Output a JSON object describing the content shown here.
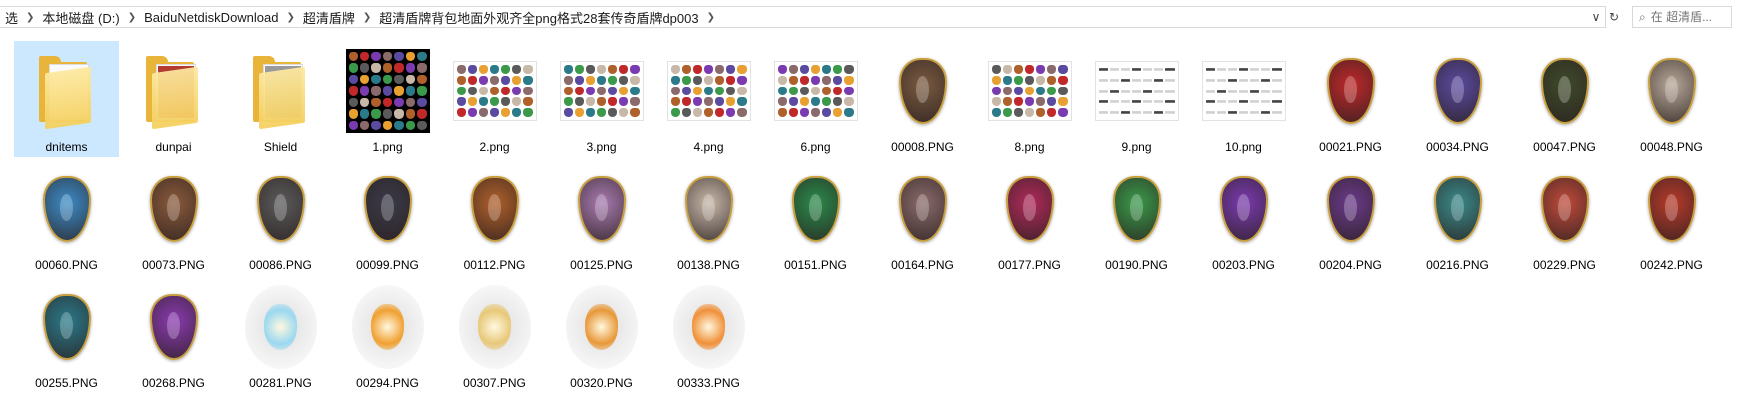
{
  "breadcrumb": [
    "选",
    "本地磁盘 (D:)",
    "BaiduNetdiskDownload",
    "超清盾牌",
    "超清盾牌背包地面外观齐全png格式28套传奇盾牌dp003"
  ],
  "search": {
    "placeholder": "在 超清盾..."
  },
  "colors": {
    "selection": "#cce8ff",
    "folder": "#e8b53a"
  },
  "files": [
    {
      "name": "dnitems",
      "kind": "folder",
      "preview": "none",
      "selected": true
    },
    {
      "name": "dunpai",
      "kind": "folder",
      "preview": "#b33a2e"
    },
    {
      "name": "Shield",
      "kind": "folder",
      "preview": "#9a9a9a"
    },
    {
      "name": "1.png",
      "kind": "sheet",
      "dark": true
    },
    {
      "name": "2.png",
      "kind": "sheet"
    },
    {
      "name": "3.png",
      "kind": "sheet"
    },
    {
      "name": "4.png",
      "kind": "sheet"
    },
    {
      "name": "6.png",
      "kind": "sheet"
    },
    {
      "name": "00008.PNG",
      "kind": "shield",
      "color": "#7a5a40"
    },
    {
      "name": "8.png",
      "kind": "sheet"
    },
    {
      "name": "9.png",
      "kind": "sheet",
      "sparse": true
    },
    {
      "name": "10.png",
      "kind": "sheet",
      "sparse": true
    },
    {
      "name": "00021.PNG",
      "kind": "shield",
      "color": "#c0282a"
    },
    {
      "name": "00034.PNG",
      "kind": "shield",
      "color": "#5a4aa0"
    },
    {
      "name": "00047.PNG",
      "kind": "shield",
      "color": "#3e4a2a"
    },
    {
      "name": "00048.PNG",
      "kind": "shield",
      "color": "#b8a898"
    },
    {
      "name": "00060.PNG",
      "kind": "shield",
      "color": "#3c8cc8"
    },
    {
      "name": "00073.PNG",
      "kind": "shield",
      "color": "#8a5a3a"
    },
    {
      "name": "00086.PNG",
      "kind": "shield",
      "color": "#5a5a5a"
    },
    {
      "name": "00099.PNG",
      "kind": "shield",
      "color": "#3a3a48"
    },
    {
      "name": "00112.PNG",
      "kind": "shield",
      "color": "#b0602a"
    },
    {
      "name": "00125.PNG",
      "kind": "shield",
      "color": "#a87ab0"
    },
    {
      "name": "00138.PNG",
      "kind": "shield",
      "color": "#c8b8a8"
    },
    {
      "name": "00151.PNG",
      "kind": "shield",
      "color": "#2a8a4a"
    },
    {
      "name": "00164.PNG",
      "kind": "shield",
      "color": "#8a6a6a"
    },
    {
      "name": "00177.PNG",
      "kind": "shield",
      "color": "#b02a5a"
    },
    {
      "name": "00190.PNG",
      "kind": "shield",
      "color": "#3a9a4a"
    },
    {
      "name": "00203.PNG",
      "kind": "shield",
      "color": "#7a3ab0"
    },
    {
      "name": "00204.PNG",
      "kind": "shield",
      "color": "#6a3a8a"
    },
    {
      "name": "00216.PNG",
      "kind": "shield",
      "color": "#3a8a8a"
    },
    {
      "name": "00229.PNG",
      "kind": "shield",
      "color": "#c04a3a"
    },
    {
      "name": "00242.PNG",
      "kind": "shield",
      "color": "#b83a2a"
    },
    {
      "name": "00255.PNG",
      "kind": "shield",
      "color": "#2a7a8a"
    },
    {
      "name": "00268.PNG",
      "kind": "shield",
      "color": "#8a3ab0"
    },
    {
      "name": "00281.PNG",
      "kind": "glow",
      "color": "#9ad8f0"
    },
    {
      "name": "00294.PNG",
      "kind": "glow",
      "color": "#f0a030"
    },
    {
      "name": "00307.PNG",
      "kind": "glow",
      "color": "#e8c878"
    },
    {
      "name": "00320.PNG",
      "kind": "glow",
      "color": "#e89838"
    },
    {
      "name": "00333.PNG",
      "kind": "glow",
      "color": "#f09038"
    }
  ]
}
